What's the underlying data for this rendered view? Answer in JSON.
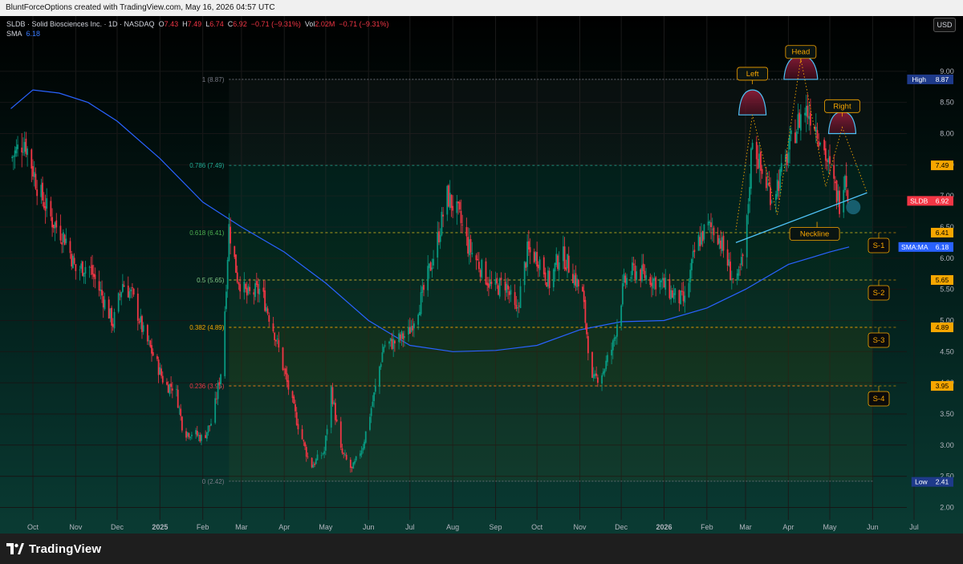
{
  "header": {
    "attribution": "BluntForceOptions created with TradingView.com, May 16, 2026 04:57 UTC"
  },
  "legend": {
    "symbol": "SLDB · Solid Biosciences Inc. · 1D · NASDAQ",
    "o_label": "O",
    "o_val": "7.43",
    "h_label": "H",
    "h_val": "7.49",
    "l_label": "L",
    "l_val": "6.74",
    "c_label": "C",
    "c_val": "6.92",
    "chg": "−0.71 (−9.31%)",
    "vol_label": "Vol",
    "vol_val": "2.02M",
    "vol_chg": "−0.71 (−9.31%)",
    "sma_label": "SMA",
    "sma_val": "6.18"
  },
  "currency_button": "USD",
  "brand": "TradingView",
  "chart_data": {
    "type": "candlestick",
    "symbol": "SLDB",
    "y_ticks": [
      "9.00",
      "8.50",
      "8.00",
      "7.50",
      "7.00",
      "6.50",
      "6.00",
      "5.50",
      "5.00",
      "4.50",
      "4.00",
      "3.50",
      "3.00",
      "2.50",
      "2.00"
    ],
    "ylim": [
      1.8,
      9.5
    ],
    "x_ticks": [
      "Oct",
      "Nov",
      "Dec",
      "2025",
      "Feb",
      "Mar",
      "Apr",
      "May",
      "Jun",
      "Jul",
      "Aug",
      "Sep",
      "Oct",
      "Nov",
      "Dec",
      "2026",
      "Feb",
      "Mar",
      "Apr",
      "May",
      "Jun",
      "Jul"
    ],
    "x_tick_dates": [
      "2024-10-01",
      "2024-11-01",
      "2024-12-01",
      "2025-01-01",
      "2025-02-01",
      "2025-03-01",
      "2025-04-01",
      "2025-05-01",
      "2025-06-01",
      "2025-07-01",
      "2025-08-01",
      "2025-09-01",
      "2025-10-01",
      "2025-11-01",
      "2025-12-01",
      "2026-01-01",
      "2026-02-01",
      "2026-03-01",
      "2026-04-01",
      "2026-05-01",
      "2026-06-01",
      "2026-07-01"
    ],
    "price_path": [
      [
        "2024-09-15",
        7.6
      ],
      [
        "2024-09-25",
        7.9
      ],
      [
        "2024-10-05",
        7.1
      ],
      [
        "2024-10-15",
        6.6
      ],
      [
        "2024-10-25",
        6.3
      ],
      [
        "2024-11-01",
        5.8
      ],
      [
        "2024-11-10",
        5.9
      ],
      [
        "2024-11-20",
        5.4
      ],
      [
        "2024-11-28",
        4.95
      ],
      [
        "2024-12-05",
        5.6
      ],
      [
        "2024-12-12",
        5.4
      ],
      [
        "2024-12-20",
        4.8
      ],
      [
        "2024-12-28",
        4.4
      ],
      [
        "2025-01-05",
        3.95
      ],
      [
        "2025-01-12",
        3.95
      ],
      [
        "2025-01-18",
        3.2
      ],
      [
        "2025-01-25",
        3.2
      ],
      [
        "2025-02-01",
        3.1
      ],
      [
        "2025-02-08",
        3.4
      ],
      [
        "2025-02-15",
        4.3
      ],
      [
        "2025-02-20",
        6.5
      ],
      [
        "2025-02-26",
        5.7
      ],
      [
        "2025-03-05",
        5.4
      ],
      [
        "2025-03-15",
        5.5
      ],
      [
        "2025-03-25",
        4.8
      ],
      [
        "2025-04-03",
        4.0
      ],
      [
        "2025-04-10",
        3.4
      ],
      [
        "2025-04-20",
        2.65
      ],
      [
        "2025-04-30",
        2.9
      ],
      [
        "2025-05-05",
        3.9
      ],
      [
        "2025-05-12",
        2.9
      ],
      [
        "2025-05-20",
        2.6
      ],
      [
        "2025-05-28",
        3.0
      ],
      [
        "2025-06-05",
        3.8
      ],
      [
        "2025-06-12",
        4.6
      ],
      [
        "2025-06-20",
        4.65
      ],
      [
        "2025-06-30",
        4.8
      ],
      [
        "2025-07-10",
        5.4
      ],
      [
        "2025-07-20",
        6.2
      ],
      [
        "2025-07-28",
        7.0
      ],
      [
        "2025-08-05",
        6.7
      ],
      [
        "2025-08-12",
        6.2
      ],
      [
        "2025-08-20",
        5.9
      ],
      [
        "2025-08-30",
        5.5
      ],
      [
        "2025-09-08",
        5.6
      ],
      [
        "2025-09-16",
        5.1
      ],
      [
        "2025-09-24",
        6.1
      ],
      [
        "2025-10-02",
        6.0
      ],
      [
        "2025-10-10",
        5.6
      ],
      [
        "2025-10-18",
        6.1
      ],
      [
        "2025-10-26",
        5.8
      ],
      [
        "2025-11-03",
        5.4
      ],
      [
        "2025-11-10",
        4.0
      ],
      [
        "2025-11-18",
        4.2
      ],
      [
        "2025-11-25",
        4.6
      ],
      [
        "2025-12-03",
        5.6
      ],
      [
        "2025-12-10",
        5.8
      ],
      [
        "2025-12-20",
        5.7
      ],
      [
        "2025-12-30",
        5.6
      ],
      [
        "2026-01-08",
        5.4
      ],
      [
        "2026-01-16",
        5.3
      ],
      [
        "2026-01-24",
        6.2
      ],
      [
        "2026-02-01",
        6.5
      ],
      [
        "2026-02-08",
        6.45
      ],
      [
        "2026-02-15",
        6.0
      ],
      [
        "2026-02-22",
        5.5
      ],
      [
        "2026-03-01",
        6.2
      ],
      [
        "2026-03-06",
        8.0
      ],
      [
        "2026-03-12",
        7.4
      ],
      [
        "2026-03-20",
        7.0
      ],
      [
        "2026-03-28",
        7.4
      ],
      [
        "2026-04-05",
        8.0
      ],
      [
        "2026-04-12",
        8.4
      ],
      [
        "2026-04-18",
        8.3
      ],
      [
        "2026-04-25",
        7.9
      ],
      [
        "2026-05-02",
        7.3
      ],
      [
        "2026-05-08",
        6.9
      ],
      [
        "2026-05-12",
        7.43
      ],
      [
        "2026-05-15",
        6.92
      ]
    ],
    "sma_path": [
      [
        "2024-09-15",
        8.4
      ],
      [
        "2024-10-01",
        8.7
      ],
      [
        "2024-10-20",
        8.65
      ],
      [
        "2024-11-10",
        8.5
      ],
      [
        "2024-12-01",
        8.2
      ],
      [
        "2025-01-01",
        7.6
      ],
      [
        "2025-02-01",
        6.9
      ],
      [
        "2025-03-01",
        6.5
      ],
      [
        "2025-04-01",
        6.1
      ],
      [
        "2025-05-01",
        5.6
      ],
      [
        "2025-06-01",
        5.0
      ],
      [
        "2025-07-01",
        4.6
      ],
      [
        "2025-08-01",
        4.5
      ],
      [
        "2025-09-01",
        4.52
      ],
      [
        "2025-10-01",
        4.6
      ],
      [
        "2025-11-01",
        4.85
      ],
      [
        "2025-12-01",
        4.98
      ],
      [
        "2026-01-01",
        5.0
      ],
      [
        "2026-02-01",
        5.2
      ],
      [
        "2026-03-01",
        5.5
      ],
      [
        "2026-04-01",
        5.9
      ],
      [
        "2026-05-01",
        6.1
      ],
      [
        "2026-05-15",
        6.18
      ]
    ],
    "fib_levels": [
      {
        "ratio": "1",
        "price": 8.87,
        "label": "1 (8.87)",
        "color": "#787b86"
      },
      {
        "ratio": "0.786",
        "price": 7.49,
        "label": "0.786 (7.49)",
        "color": "#22ab94"
      },
      {
        "ratio": "0.618",
        "price": 6.41,
        "label": "0.618 (6.41)",
        "color": "#4caf50"
      },
      {
        "ratio": "0.5",
        "price": 5.65,
        "label": "0.5 (5.65)",
        "color": "#81c784"
      },
      {
        "ratio": "0.382",
        "price": 4.89,
        "label": "0.382 (4.89)",
        "color": "#f7a600"
      },
      {
        "ratio": "0.236",
        "price": 3.95,
        "label": "0.236 (3.95)",
        "color": "#f23645"
      },
      {
        "ratio": "0",
        "price": 2.42,
        "label": "0 (2.42)",
        "color": "#787b86"
      }
    ],
    "fib_start": "2025-02-20",
    "fib_end": "2026-06-01",
    "price_labels": [
      {
        "text": "High",
        "value": "8.87",
        "price": 8.87,
        "color": "#1e3a8a",
        "kind": "split"
      },
      {
        "text": "",
        "value": "7.49",
        "price": 7.49,
        "color": "#f7a600",
        "kind": "plain"
      },
      {
        "text": "SLDB",
        "value": "6.92",
        "price": 6.92,
        "color": "#f23645",
        "kind": "split"
      },
      {
        "text": "",
        "value": "6.41",
        "price": 6.41,
        "color": "#f7a600",
        "kind": "plain"
      },
      {
        "text": "SMA:MA",
        "value": "6.18",
        "price": 6.18,
        "color": "#2962ff",
        "kind": "split"
      },
      {
        "text": "",
        "value": "5.65",
        "price": 5.65,
        "color": "#f7a600",
        "kind": "plain"
      },
      {
        "text": "",
        "value": "4.89",
        "price": 4.89,
        "color": "#f7a600",
        "kind": "plain"
      },
      {
        "text": "",
        "value": "3.95",
        "price": 3.95,
        "color": "#f7a600",
        "kind": "plain"
      },
      {
        "text": "Low",
        "value": "2.41",
        "price": 2.41,
        "color": "#1e3a8a",
        "kind": "split"
      }
    ],
    "support_labels": [
      {
        "text": "S-1",
        "price": 6.41
      },
      {
        "text": "S-2",
        "price": 5.65
      },
      {
        "text": "S-3",
        "price": 4.89
      },
      {
        "text": "S-4",
        "price": 3.95
      }
    ],
    "pattern_labels": [
      {
        "text": "Left",
        "date": "2026-03-06",
        "price": 8.87
      },
      {
        "text": "Head",
        "date": "2026-04-10",
        "price": 9.22
      },
      {
        "text": "Right",
        "date": "2026-05-10",
        "price": 8.35
      },
      {
        "text": "Neckline",
        "date": "2026-04-20",
        "price": 6.3
      }
    ],
    "neckline": [
      [
        "2026-02-22",
        6.25
      ],
      [
        "2026-05-28",
        7.05
      ]
    ],
    "colors": {
      "up": "#089981",
      "down": "#f23645",
      "sma": "#2962ff",
      "neckline": "#4fc3f7",
      "label_border": "#f7a600",
      "label_text": "#f7a600"
    }
  }
}
